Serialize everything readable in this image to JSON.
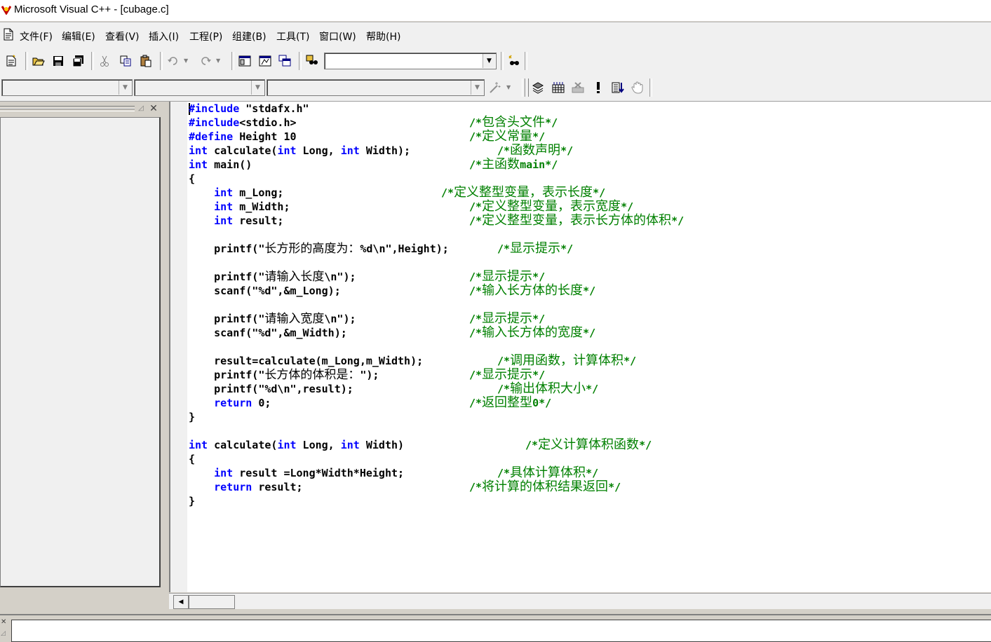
{
  "window": {
    "title": "Microsoft Visual C++ - [cubage.c]"
  },
  "menu": [
    "文件(F)",
    "编辑(E)",
    "查看(V)",
    "插入(I)",
    "工程(P)",
    "组建(B)",
    "工具(T)",
    "窗口(W)",
    "帮助(H)"
  ],
  "toolbar": {
    "buttons": [
      "new-text-file",
      "open",
      "save",
      "save-all",
      "cut",
      "copy",
      "paste",
      "undo",
      "redo",
      "workspace",
      "output",
      "window-list",
      "find-in-files",
      "find"
    ],
    "find_combo_value": ""
  },
  "build_toolbar": {
    "combo1_value": "",
    "combo2_value": "",
    "combo3_value": "",
    "buttons": [
      "wizard",
      "compile",
      "build",
      "stop-build",
      "execute",
      "go",
      "insert-remove-breakpoint"
    ]
  },
  "editor": {
    "filename": "cubage.c",
    "lines": [
      {
        "code": "#include \"stdafx.h\"",
        "comment": ""
      },
      {
        "code": "#include<stdio.h>",
        "comment": "/*包含头文件*/"
      },
      {
        "code": "#define Height 10",
        "comment": "/*定义常量*/"
      },
      {
        "code": "int calculate(int Long, int Width);",
        "comment": "/*函数声明*/"
      },
      {
        "code": "int main()",
        "comment": "/*主函数main*/"
      },
      {
        "code": "{",
        "comment": ""
      },
      {
        "code": "    int m_Long;",
        "comment": "/*定义整型变量，表示长度*/"
      },
      {
        "code": "    int m_Width;",
        "comment": "/*定义整型变量，表示宽度*/"
      },
      {
        "code": "    int result;",
        "comment": "/*定义整型变量，表示长方体的体积*/"
      },
      {
        "code": "",
        "comment": ""
      },
      {
        "code": "    printf(\"长方形的高度为：%d\\n\",Height);",
        "comment": "/*显示提示*/"
      },
      {
        "code": "",
        "comment": ""
      },
      {
        "code": "    printf(\"请输入长度\\n\");",
        "comment": "/*显示提示*/"
      },
      {
        "code": "    scanf(\"%d\",&m_Long);",
        "comment": "/*输入长方体的长度*/"
      },
      {
        "code": "",
        "comment": ""
      },
      {
        "code": "    printf(\"请输入宽度\\n\");",
        "comment": "/*显示提示*/"
      },
      {
        "code": "    scanf(\"%d\",&m_Width);",
        "comment": "/*输入长方体的宽度*/"
      },
      {
        "code": "",
        "comment": ""
      },
      {
        "code": "    result=calculate(m_Long,m_Width);",
        "comment": "/*调用函数，计算体积*/"
      },
      {
        "code": "    printf(\"长方体的体积是：\");",
        "comment": "/*显示提示*/"
      },
      {
        "code": "    printf(\"%d\\n\",result);",
        "comment": "/*输出体积大小*/"
      },
      {
        "code": "    return 0;",
        "comment": "/*返回整型0*/"
      },
      {
        "code": "}",
        "comment": ""
      },
      {
        "code": "",
        "comment": ""
      },
      {
        "code": "int calculate(int Long, int Width)",
        "comment": "/*定义计算体积函数*/"
      },
      {
        "code": "{",
        "comment": ""
      },
      {
        "code": "    int result =Long*Width*Height;",
        "comment": "/*具体计算体积*/"
      },
      {
        "code": "    return result;",
        "comment": "/*将计算的体积结果返回*/"
      },
      {
        "code": "}",
        "comment": ""
      }
    ]
  },
  "colors": {
    "keyword": "#0000ff",
    "comment": "#008000",
    "text": "#000000",
    "face": "#f0f0f0"
  }
}
